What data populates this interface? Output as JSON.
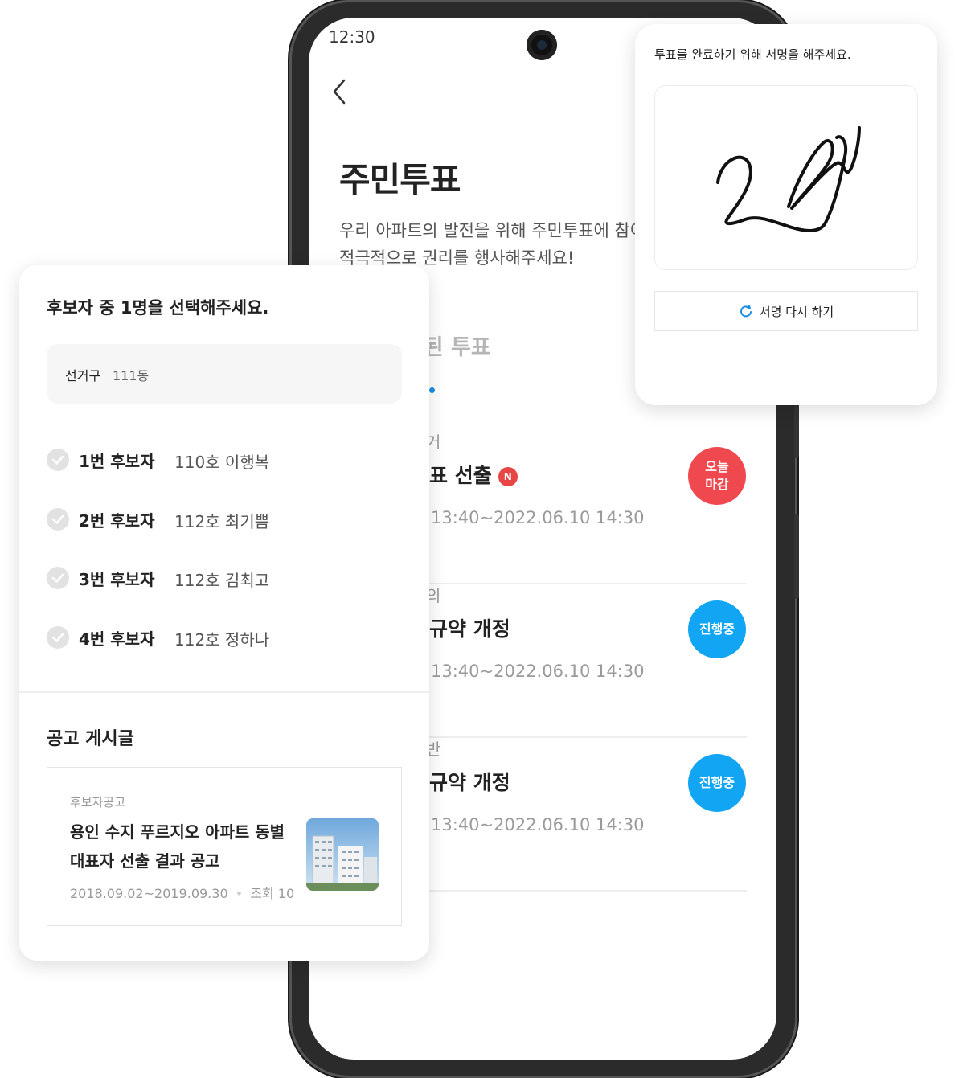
{
  "status_bar": {
    "time": "12:30"
  },
  "header": {
    "title": "주민투표",
    "description_line1": "우리 아파트의 발전을 위해 주민투표에 참여",
    "description_line2": "적극적으로 권리를 행사해주세요!"
  },
  "tabs": [
    {
      "label": "투표",
      "active": true
    },
    {
      "label": "완료된 투표",
      "active": false
    }
  ],
  "votes": [
    {
      "category": "거",
      "title": "표 선출",
      "new_badge": "N",
      "date": "13:40~2022.06.10 14:30",
      "status": "오늘\n마감",
      "status_color": "#f0484f"
    },
    {
      "category": "의",
      "title": "규약 개정",
      "date": "13:40~2022.06.10 14:30",
      "status": "진행중",
      "status_color": "#12a5f4"
    },
    {
      "category": "반",
      "title": "규약 개정",
      "date": "13:40~2022.06.10 14:30",
      "status": "진행중",
      "status_color": "#12a5f4"
    }
  ],
  "signature_card": {
    "prompt": "투표를 완료하기 위해 서명을 해주세요.",
    "retry_label": "서명 다시 하기",
    "accent": "#1a8fe3"
  },
  "candidate_card": {
    "prompt": "후보자 중 1명을 선택해주세요.",
    "district_label": "선거구",
    "district_value": "111동",
    "candidates": [
      {
        "number": "1번 후보자",
        "name": "110호 이행복"
      },
      {
        "number": "2번 후보자",
        "name": "112호 최기쁨"
      },
      {
        "number": "3번 후보자",
        "name": "112호 김최고"
      },
      {
        "number": "4번 후보자",
        "name": "112호 정하나"
      }
    ]
  },
  "notice": {
    "heading": "공고 게시글",
    "category": "후보자공고",
    "title": "용인 수지 푸르지오 아파트 동별 대표자 선출 결과 공고",
    "period": "2018.09.02~2019.09.30",
    "views": "조회 10"
  }
}
